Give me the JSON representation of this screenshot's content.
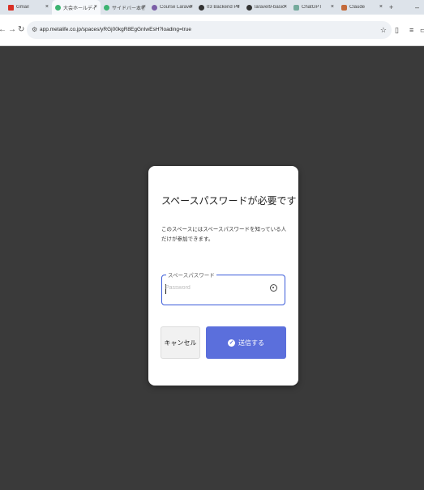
{
  "browser": {
    "tabs": [
      {
        "label": "Gmail",
        "icon": "gmail-icon",
        "color": "#d93025",
        "active": false
      },
      {
        "label": "大会ホールディング",
        "icon": "metalife-icon",
        "color": "#3cb371",
        "active": true
      },
      {
        "label": "サイドバー本報告",
        "icon": "metalife-icon",
        "color": "#3cb371",
        "active": false
      },
      {
        "label": "Course Laravel",
        "icon": "course-icon",
        "color": "#7b5ea7",
        "active": false
      },
      {
        "label": "03 Backend Port",
        "icon": "github-icon",
        "color": "#333333",
        "active": false
      },
      {
        "label": "laravel9-basic-…",
        "icon": "github-icon",
        "color": "#333333",
        "active": false
      },
      {
        "label": "ChatGPT",
        "icon": "chatgpt-icon",
        "color": "#74aa9c",
        "active": false
      },
      {
        "label": "Claude",
        "icon": "claude-icon",
        "color": "#c46a3a",
        "active": false
      }
    ],
    "new_tab": "+",
    "minimize": "–",
    "url": "app.metalife.co.jp/spaces/yRGj00kgR8EgGnIwEsH?loading=true"
  },
  "modal": {
    "title": "スペースパスワードが必要です",
    "description": "このスペースにはスペースパスワードを知っている人だけが参加できます。",
    "field_label": "スペースパスワード",
    "field_placeholder": "Password",
    "cancel_label": "キャンセル",
    "submit_label": "送信する"
  },
  "colors": {
    "background": "#3a3a3a",
    "accent": "#5b6fdc",
    "field_border": "#3a5bd9"
  }
}
